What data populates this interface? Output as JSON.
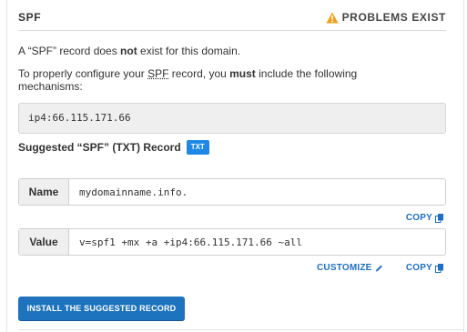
{
  "header": {
    "title": "SPF",
    "status_text": "PROBLEMS EXIST",
    "status_icon": "warning-triangle-icon",
    "status_color": "#f0a11b"
  },
  "body": {
    "line1_prefix": "A “SPF” record does ",
    "line1_bold": "not",
    "line1_suffix": " exist for this domain.",
    "line2_a": "To properly configure your ",
    "line2_abbr": "SPF",
    "line2_b": " record, you ",
    "line2_bold": "must",
    "line2_c": " include the following mechanisms:"
  },
  "mechanisms": "ip4:66.115.171.66",
  "suggested": {
    "label": "Suggested “SPF” (TXT) Record",
    "badge": "TXT",
    "badge_color": "#1e88e5"
  },
  "name_row": {
    "label": "Name",
    "value": "mydomainname.info."
  },
  "value_row": {
    "label": "Value",
    "value": "v=spf1 +mx +a +ip4:66.115.171.66 ~all"
  },
  "actions": {
    "copy": "COPY",
    "customize": "CUSTOMIZE",
    "install": "INSTALL THE SUGGESTED RECORD",
    "accent": "#1e73be"
  }
}
